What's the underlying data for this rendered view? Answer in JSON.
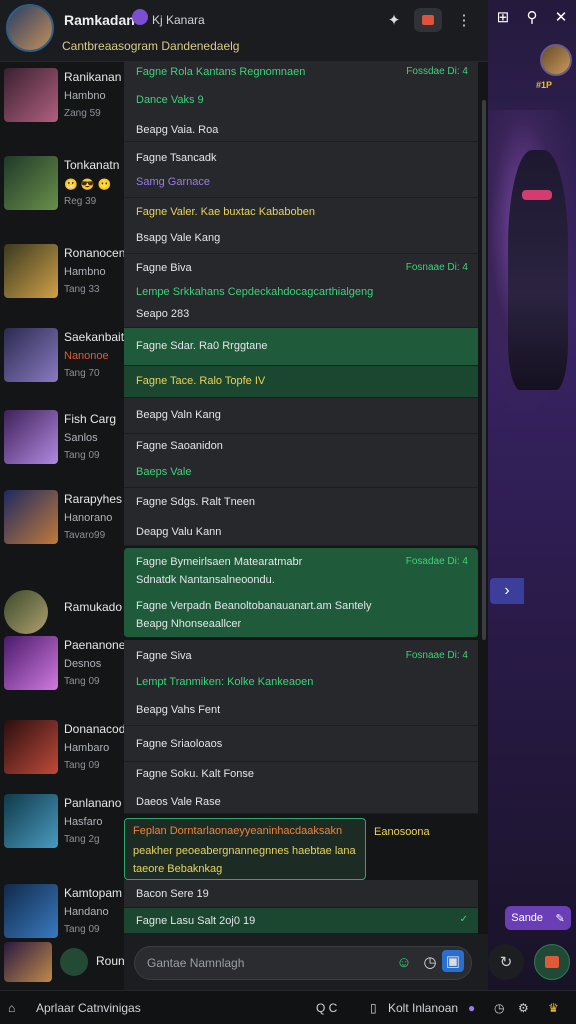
{
  "header": {
    "title": "Ramkadan",
    "subtitle": "Kj Kanara",
    "status_line": "Cantbreaasogram  Dandenedaelg"
  },
  "game": {
    "rank_label": "#1P",
    "send_label": "Sande",
    "accent": "#6a3fb5"
  },
  "contacts": [
    {
      "name": "Ranikanan",
      "line2": "Hambno",
      "line3": "Zang 59"
    },
    {
      "name": "Tonkanatn",
      "line2": "",
      "line3": "Reg 39"
    },
    {
      "name": "Ronanocene",
      "line2": "Hambno",
      "line3": "Tang 33"
    },
    {
      "name": "Saekanbaita",
      "line2": "Nanonoe",
      "line3": "Tang 70"
    },
    {
      "name": "Fish Carg",
      "line2": "Sanlos",
      "line3": "Tang 09"
    },
    {
      "name": "Rarapyhes",
      "line2": "Hanorano",
      "line3": "Tavaro99"
    },
    {
      "name": "Ramukado",
      "line2": "",
      "line3": ""
    },
    {
      "name": "Paenanone",
      "line2": "Desnos",
      "line3": "Tang 09"
    },
    {
      "name": "Donanacod",
      "line2": "Hambaro",
      "line3": "Tang 09"
    },
    {
      "name": "Panlanano",
      "line2": "Hasfaro",
      "line3": "Tang 2g"
    },
    {
      "name": "Kamtopam",
      "line2": "Handano",
      "line3": "Tang 09"
    },
    {
      "name": "Roun",
      "line2": "",
      "line3": ""
    }
  ],
  "messages": [
    {
      "top": "Fagne  Rola Kantans Regnomnaen",
      "ts": "Fossdae Di: 4",
      "mid": "Dance  Vaks 9",
      "bot": "Beapg  Vaia. Roa"
    },
    {
      "top": "Fagne  Tsancadk",
      "ts": "",
      "mid": "Samg  Garnace",
      "bot": ""
    },
    {
      "top": "Fagne  Valer. Kae buxtac Kababoben",
      "ts": "",
      "mid": "",
      "bot": "Bsapg  Vale Kang"
    },
    {
      "top": "Fagne  Biva",
      "ts": "Fosnaae Di: 4",
      "mid": "Lempe  Srkkahans Cepdeckahdocagcarthialgeng",
      "bot": "Seapo  283"
    },
    {
      "top": "Fagne  Sdar. Ra0 Rrggtane",
      "ts": "",
      "mid": "",
      "bot": ""
    },
    {
      "top": "Fagne  Tace. Ralo Topfe IV",
      "ts": "",
      "mid": "",
      "bot": ""
    },
    {
      "top": "Beapg  Valn Kang",
      "ts": "",
      "mid": "",
      "bot": ""
    },
    {
      "top": "Fagne  Saoanidon",
      "ts": "",
      "mid": "Baeps  Vale",
      "bot": ""
    },
    {
      "top": "Fagne  Sdgs. Ralt Tneen",
      "ts": "",
      "mid": "",
      "bot": "Deapg  Valu Kann"
    },
    {
      "top": "Fagne  Bymeirlsaen  Matearatmabr",
      "ts": "Fosadae Di: 4",
      "mid": "Sdnatdk Nantansalneoondu.",
      "bot": "Fagne  Verpadn Beanoltobanauanart.am Santely"
    },
    {
      "top": "Beapg  Nhonseaallcer",
      "ts": "",
      "mid": "",
      "bot": ""
    },
    {
      "top": "Fagne  Siva",
      "ts": "Fosnaae Di: 4",
      "mid": "Lempt  Tranmiken: Kolke Kankeaoen",
      "bot": "Beapg  Vahs Fent"
    },
    {
      "top": "Fagne  Sriaoloaos",
      "ts": "",
      "mid": "",
      "bot": ""
    },
    {
      "top": "Fagne  Soku. Kalt Fonse",
      "ts": "",
      "mid": "Daeos  Vale Rase",
      "bot": ""
    },
    {
      "top": "Feplan  Dorntarlaonaeyyeaninhacdaaksakn",
      "ts": "Eanosoona",
      "mid": "peakher  peoeabergnannegnnes  haebtae lana",
      "bot": "taeore Bebaknkag"
    },
    {
      "top": "Bacon  Sere 19",
      "ts": "",
      "mid": "",
      "bot": ""
    },
    {
      "top": "Fagne  Lasu Salt 2oj0 19",
      "ts": "",
      "mid": "",
      "bot": ""
    }
  ],
  "composer": {
    "placeholder": "Gantae Namnlagh"
  },
  "bottom_bar": {
    "left": "Aprlaar Catnvinigas",
    "search": "Q C",
    "right": "Kolt Inlanoan"
  }
}
